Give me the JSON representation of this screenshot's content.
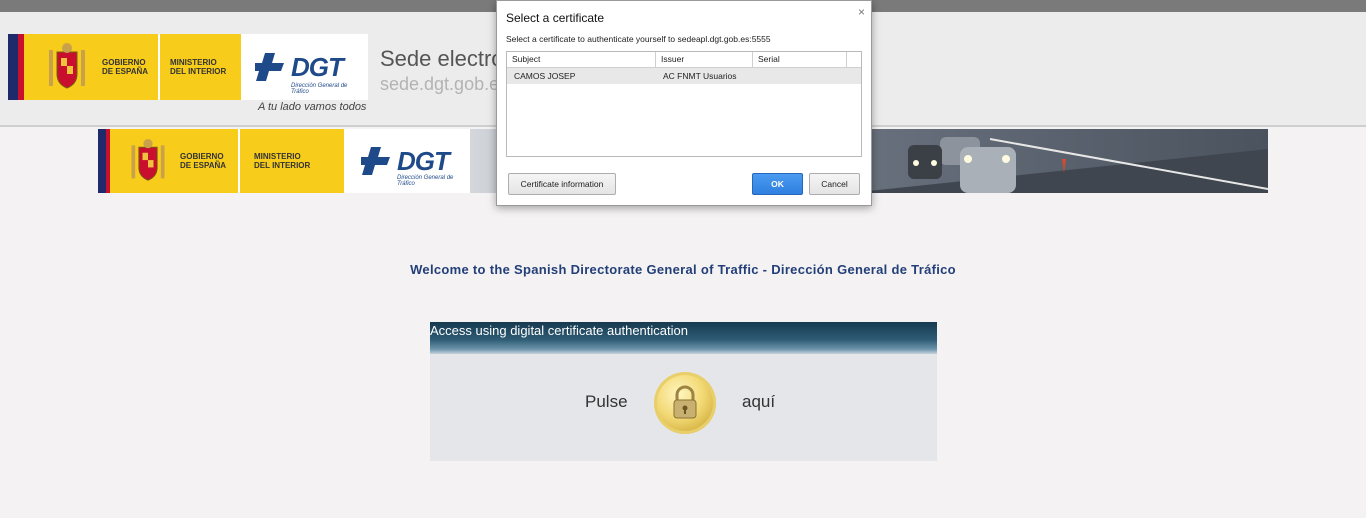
{
  "header": {
    "gobierno_text": "GOBIERNO\nDE ESPAÑA",
    "ministerio_text": "MINISTERIO\nDEL INTERIOR",
    "dgt_word": "DGT",
    "dgt_sub": "Dirección General de Tráfico",
    "tagline": "A tu lado vamos todos",
    "sede_title": "Sede electró",
    "sede_url": "sede.dgt.gob.es"
  },
  "welcome": "Welcome to the Spanish Directorate General of Traffic - Dirección General de Tráfico",
  "access": {
    "header": "Access using digital certificate authentication",
    "pulse": "Pulse",
    "aqui": "aquí"
  },
  "dialog": {
    "title": "Select a certificate",
    "close": "×",
    "prompt": "Select a certificate to authenticate yourself to sedeapl.dgt.gob.es:5555",
    "columns": [
      "Subject",
      "Issuer",
      "Serial"
    ],
    "rows": [
      {
        "subject": "CAMOS JOSEP",
        "issuer": "AC FNMT Usuarios",
        "serial": ""
      }
    ],
    "cert_info_button": "Certificate information",
    "ok_button": "OK",
    "cancel_button": "Cancel"
  },
  "colors": {
    "flag_red": "#c8102e",
    "flag_yellow": "#f7cc1a",
    "dgt_blue": "#1f4a8a",
    "welcome_blue": "#233f78",
    "ok_blue": "#2f7fe0"
  }
}
